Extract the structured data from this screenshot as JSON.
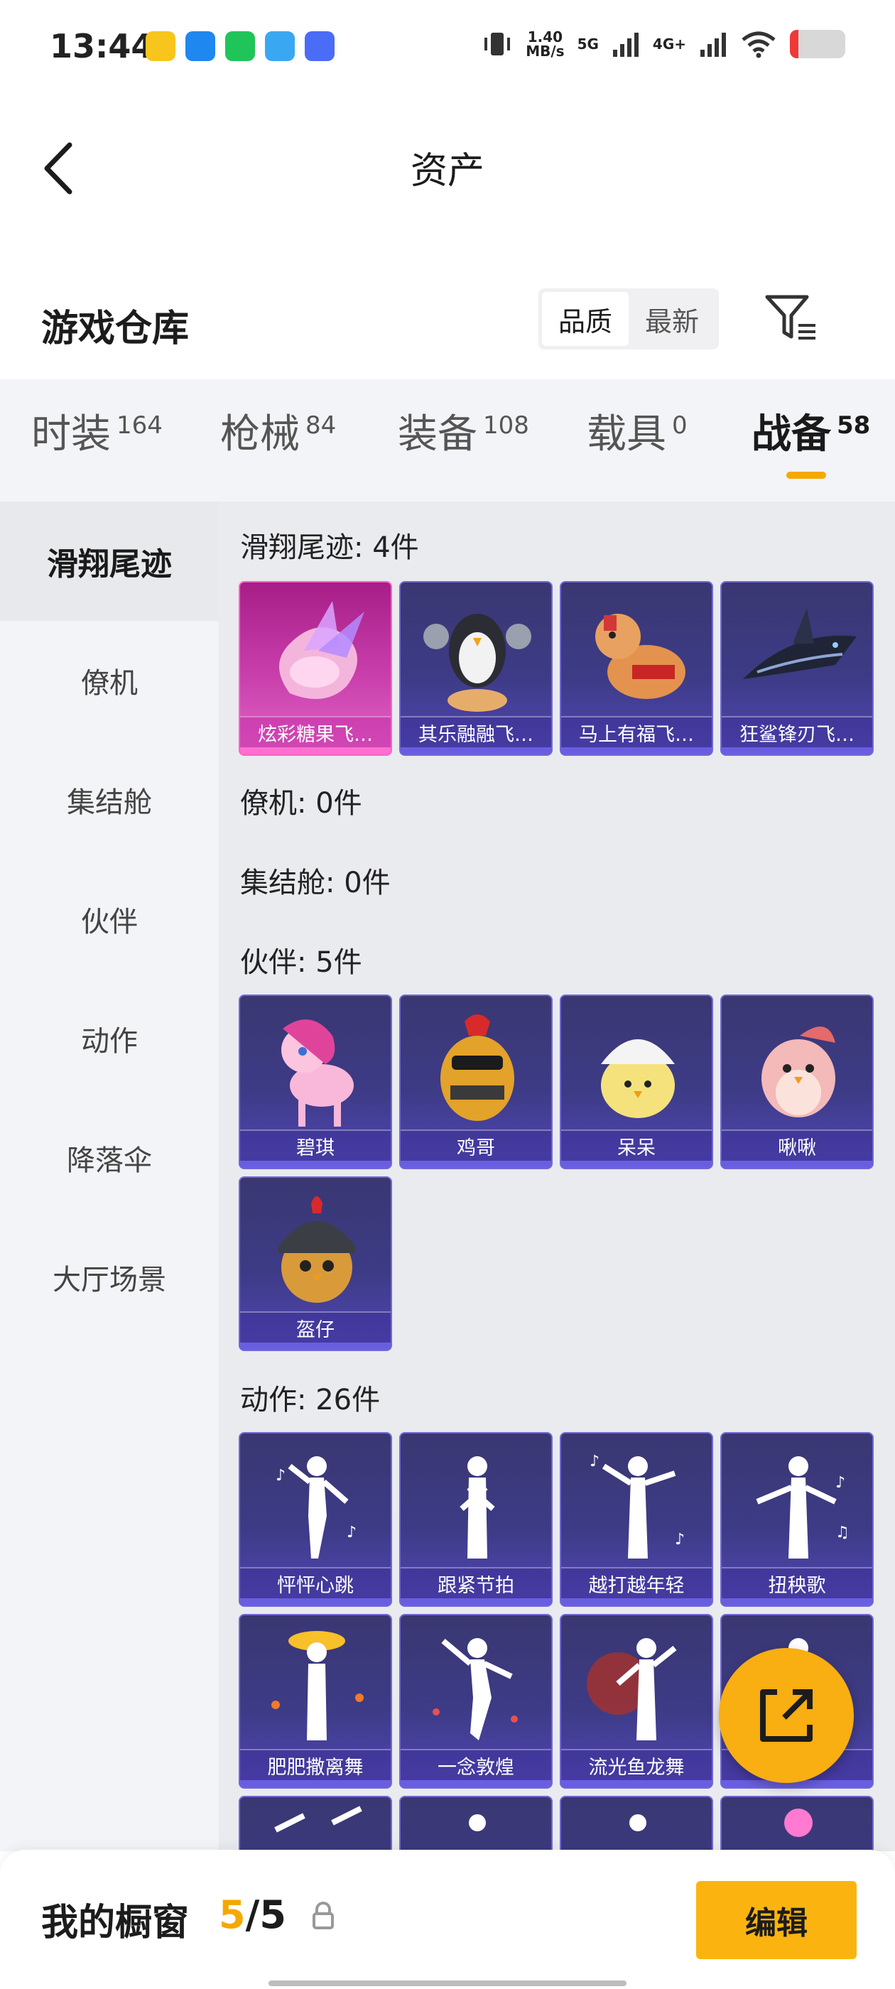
{
  "status_bar": {
    "time": "13:44",
    "net_speed_value": "1.40",
    "net_speed_unit": "MB/s",
    "net_5g": "5G",
    "net_4g": "4G+",
    "battery_level": 0.15,
    "app_icon_colors": [
      "#f7c51c",
      "#1e88f0",
      "#20c55a",
      "#3aa7f2",
      "#4a6cf7"
    ]
  },
  "header": {
    "title": "资产"
  },
  "warehouse": {
    "title": "游戏仓库",
    "sort_options": [
      "品质",
      "最新"
    ],
    "sort_selected": "品质"
  },
  "tabs": [
    {
      "label": "时装",
      "count": "164"
    },
    {
      "label": "枪械",
      "count": "84"
    },
    {
      "label": "装备",
      "count": "108"
    },
    {
      "label": "载具",
      "count": "0"
    },
    {
      "label": "战备",
      "count": "58",
      "active": true
    }
  ],
  "sidebar": {
    "items": [
      "滑翔尾迹",
      "僚机",
      "集结舱",
      "伙伴",
      "动作",
      "降落伞",
      "大厅场景"
    ],
    "active": "滑翔尾迹"
  },
  "groups": {
    "trail": {
      "heading": "滑翔尾迹: 4件",
      "items": [
        "炫彩糖果飞…",
        "其乐融融飞…",
        "马上有福飞…",
        "狂鲨锋刃飞…"
      ]
    },
    "wingman": {
      "heading": "僚机: 0件"
    },
    "pod": {
      "heading": "集结舱: 0件"
    },
    "buddy": {
      "heading": "伙伴: 5件",
      "items": [
        "碧琪",
        "鸡哥",
        "呆呆",
        "啾啾",
        "盔仔"
      ]
    },
    "emote": {
      "heading": "动作: 26件",
      "items": [
        "怦怦心跳",
        "跟紧节拍",
        "越打越年轻",
        "扭秧歌",
        "肥肥撒离舞",
        "一念敦煌",
        "流光鱼龙舞",
        ""
      ]
    }
  },
  "bottom": {
    "showcase_label": "我的橱窗",
    "showcase_current": "5",
    "showcase_sep": "/",
    "showcase_total": "5",
    "edit_label": "编辑"
  },
  "colors": {
    "accent": "#f5a800",
    "card_purple": "#3d3b86",
    "card_pink": "#c93fac",
    "fab": "#f9ae11"
  }
}
